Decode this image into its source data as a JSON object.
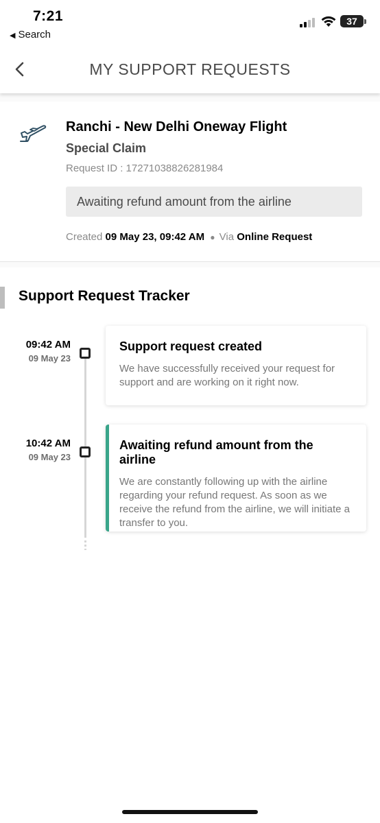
{
  "status_bar": {
    "time": "7:21",
    "back_label": "Search",
    "battery": "37"
  },
  "header": {
    "title": "MY SUPPORT REQUESTS",
    "back_icon": "chevron-left-icon"
  },
  "request": {
    "icon": "airplane-icon",
    "title": "Ranchi - New Delhi Oneway Flight",
    "type": "Special Claim",
    "request_id": "Request ID : 17271038826281984",
    "status": "Awaiting refund amount from the airline",
    "created_label": "Created",
    "created_value": "09 May 23, 09:42 AM",
    "via_label": "Via",
    "via_value": "Online Request"
  },
  "tracker": {
    "title": "Support Request Tracker",
    "events": [
      {
        "time": "09:42 AM",
        "date": "09 May 23",
        "title": "Support request created",
        "description": "We have successfully received your request for support and are working on it right now.",
        "active": false
      },
      {
        "time": "10:42 AM",
        "date": "09 May 23",
        "title": "Awaiting refund amount from the airline",
        "description": "We are constantly following up with the airline regarding your refund request. As soon as we receive the refund from the airline, we will initiate a transfer to you.",
        "active": true
      }
    ],
    "active_color": "#3aa58a"
  }
}
